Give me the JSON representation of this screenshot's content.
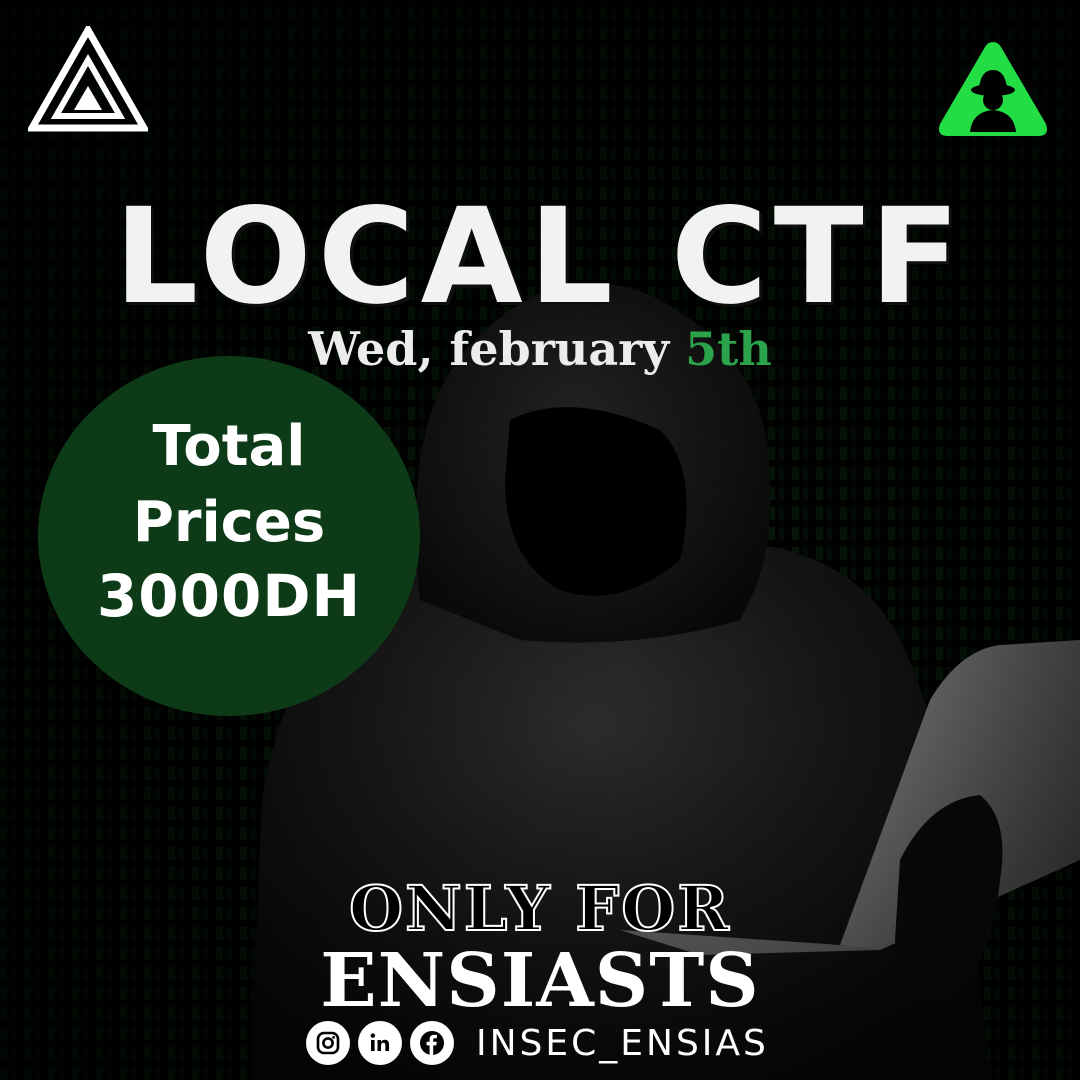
{
  "poster": {
    "title": "LOCAL CTF",
    "date_prefix": "Wed, february ",
    "date_highlight": "5th",
    "prize": {
      "line1": "Total",
      "line2": "Prices",
      "line3": "3000DH"
    },
    "audience": {
      "line1": "ONLY FOR",
      "line2": "ENSIASTS"
    },
    "social": {
      "icons": [
        "instagram-icon",
        "linkedin-icon",
        "facebook-icon"
      ],
      "handle": "INSEC_ENSIAS"
    },
    "colors": {
      "accent_green": "#2aa34a",
      "circle_green": "#0d3b17",
      "logo_green": "#22dd44"
    }
  }
}
